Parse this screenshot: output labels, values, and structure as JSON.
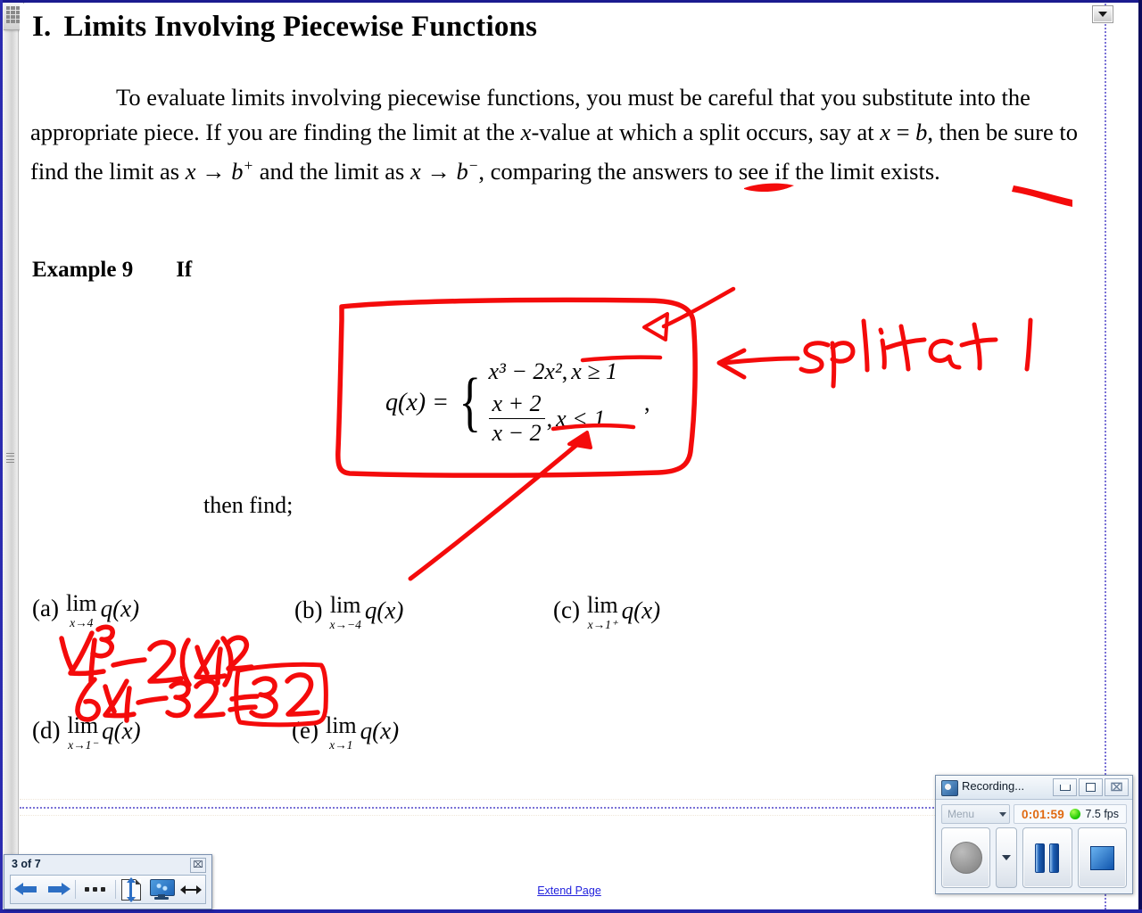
{
  "document": {
    "heading_numeral": "I.",
    "heading_text": "Limits Involving Piecewise Functions",
    "paragraph": {
      "line1_a": "To evaluate limits involving piecewise functions, you must be careful that you",
      "line2_a": "substitute into the appropriate piece.  If you are finding the limit at the ",
      "line2_x": "x",
      "line2_b": "-value at which a",
      "line3_a": "split occurs, say at ",
      "line3_x": "x",
      "line3_eq": " = ",
      "line3_b": "b",
      "line3_c": ", then be sure to find the limit as ",
      "line3_x2": "x",
      "line3_arrow": " → ",
      "line3_b2": "b",
      "line3_sup2": "+",
      "line3_d": " and the limit as ",
      "line3_x3": "x",
      "line3_arrow2": " → ",
      "line3_b3": "b",
      "line3_sup3": "−",
      "line3_e": ",",
      "line4_a": "comparing the answers to see if the limit exists."
    },
    "example_label": "Example 9",
    "example_if": "If",
    "then_find": "then find;",
    "piecewise": {
      "lhs": "q(x) =",
      "branch1_expr": "x³ − 2x²",
      "branch1_comma": ",",
      "branch1_cond": "x ≥ 1",
      "branch2_num": "x + 2",
      "branch2_den": "x − 2",
      "branch2_comma": ",",
      "branch2_cond": "x < 1",
      "trailing_comma": ","
    },
    "limits": [
      {
        "tag": "(a)",
        "op": "lim",
        "sub": "x→4",
        "fn": "q(x)"
      },
      {
        "tag": "(b)",
        "op": "lim",
        "sub": "x→−4",
        "fn": "q(x)"
      },
      {
        "tag": "(c)",
        "op": "lim",
        "sub": "x→1⁺",
        "fn": "q(x)"
      },
      {
        "tag": "(d)",
        "op": "lim",
        "sub": "x→1⁻",
        "fn": "q(x)"
      },
      {
        "tag": "(e)",
        "op": "lim",
        "sub": "x→1",
        "fn": "q(x)"
      }
    ],
    "extend_page_link": "Extend Page"
  },
  "annotations": {
    "ink_color": "#f40b0b",
    "split_note": "split at 1",
    "work_line1": "4³ − 2(4)²",
    "work_line2": "64 − 32 =",
    "boxed_answer": "32"
  },
  "page_nav": {
    "page_indicator": "3 of 7",
    "close_glyph": "⌧",
    "buttons": [
      {
        "name": "previous-page",
        "label": ""
      },
      {
        "name": "next-page",
        "label": ""
      },
      {
        "name": "more-options",
        "label": ""
      },
      {
        "name": "fit-page-height",
        "label": ""
      },
      {
        "name": "full-screen",
        "label": ""
      },
      {
        "name": "fit-page-width",
        "label": ""
      }
    ]
  },
  "recording_panel": {
    "title": "Recording...",
    "menu_label": "Menu",
    "elapsed_time": "0:01:59",
    "fps": "7.5 fps",
    "status_color": "#16c400",
    "minimize_label": "",
    "restore_label": "",
    "close_label": "⌧",
    "record_button": "record",
    "record_dropdown": "record-options",
    "pause_button": "pause",
    "stop_button": "stop"
  },
  "corner": {
    "dropdown_label": ""
  }
}
